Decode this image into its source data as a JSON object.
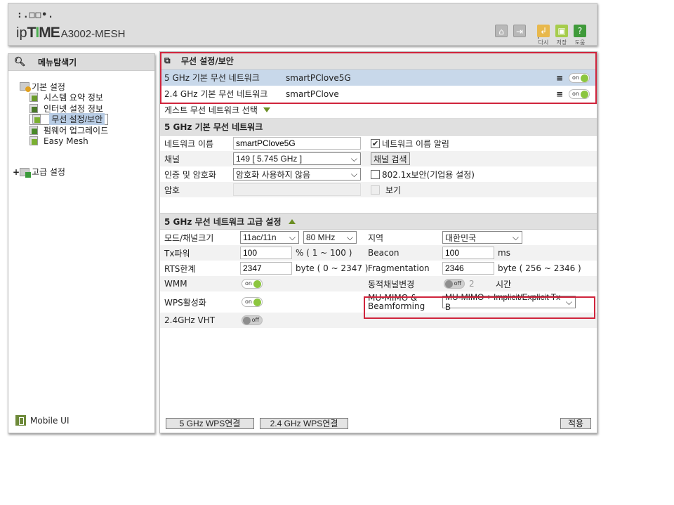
{
  "header": {
    "logo_dots": ":.□□•.",
    "logo_ip": "ip",
    "logo_t": "T",
    "logo_i": "I",
    "logo_me": "ME",
    "model": "A3002-MESH",
    "icons": {
      "home": "home-icon",
      "logout": "logout-icon",
      "reload": "reload-icon",
      "save": "save-icon",
      "help": "help-icon"
    },
    "reload_label": "다시",
    "save_label": "저장",
    "help_label": "도움"
  },
  "sidebar": {
    "title": "메뉴탐색기",
    "basic_group": "기본 설정",
    "items": [
      {
        "label": "시스템 요약 정보"
      },
      {
        "label": "인터넷 설정 정보"
      },
      {
        "label": "무선 설정/보안",
        "selected": true
      },
      {
        "label": "펌웨어 업그레이드"
      },
      {
        "label": "Easy Mesh"
      }
    ],
    "advanced_expander": "+",
    "advanced_group": "고급 설정",
    "mobile_ui": "Mobile UI"
  },
  "main": {
    "title": "무선 설정/보안",
    "networks": [
      {
        "name": "5 GHz 기본 무선 네트워크",
        "ssid": "smartPClove5G",
        "toggle": "on"
      },
      {
        "name": "2.4 GHz 기본 무선 네트워크",
        "ssid": "smartPClove",
        "toggle": "on"
      }
    ],
    "guest_select": "게스트 무선 네트워크 선택",
    "basic": {
      "title": "5 GHz 기본 무선 네트워크",
      "network_name_label": "네트워크 이름",
      "network_name_value": "smartPClove5G",
      "broadcast_label": "네트워크 이름 알림",
      "broadcast_checked": true,
      "channel_label": "채널",
      "channel_value": "149 [ 5.745 GHz ]",
      "channel_search": "채널 검색",
      "auth_label": "인증 및 암호화",
      "auth_value": "암호화 사용하지 않음",
      "dot1x_label": "802.1x보안(기업용 설정)",
      "dot1x_checked": false,
      "password_label": "암호",
      "password_value": "",
      "show_label": "보기"
    },
    "advanced": {
      "title": "5 GHz 무선 네트워크 고급 설정",
      "mode_label": "모드/채널크기",
      "mode_value": "11ac/11n",
      "width_value": "80 MHz",
      "region_label": "지역",
      "region_value": "대한민국",
      "tx_label": "Tx파워",
      "tx_value": "100",
      "tx_range": "% ( 1 ~ 100 )",
      "beacon_label": "Beacon",
      "beacon_value": "100",
      "beacon_unit": "ms",
      "rts_label": "RTS한계",
      "rts_value": "2347",
      "rts_range": "byte ( 0 ~ 2347 )",
      "frag_label": "Fragmentation",
      "frag_value": "2346",
      "frag_range": "byte ( 256 ~ 2346 )",
      "wmm_label": "WMM",
      "wmm_state": "on",
      "dyn_label": "동적채널변경",
      "dyn_state": "off",
      "dyn_value": "2",
      "dyn_unit": "시간",
      "wps_label": "WPS활성화",
      "wps_state": "on",
      "mumimo_label_1": "MU-MIMO &",
      "mumimo_label_2": "Beamforming",
      "mumimo_value": "MU-MIMO + Implicit/Explicit Tx B",
      "vht_label": "2.4GHz VHT",
      "vht_state": "off"
    },
    "buttons": {
      "wps5": "5 GHz WPS연결",
      "wps24": "2.4 GHz WPS연결",
      "apply": "적용"
    }
  },
  "colors": {
    "highlight_border": "#d0243c",
    "toggle_on": "#8cc63f",
    "accent_green": "#6b8e23",
    "selected_row": "#c8d8ea"
  }
}
